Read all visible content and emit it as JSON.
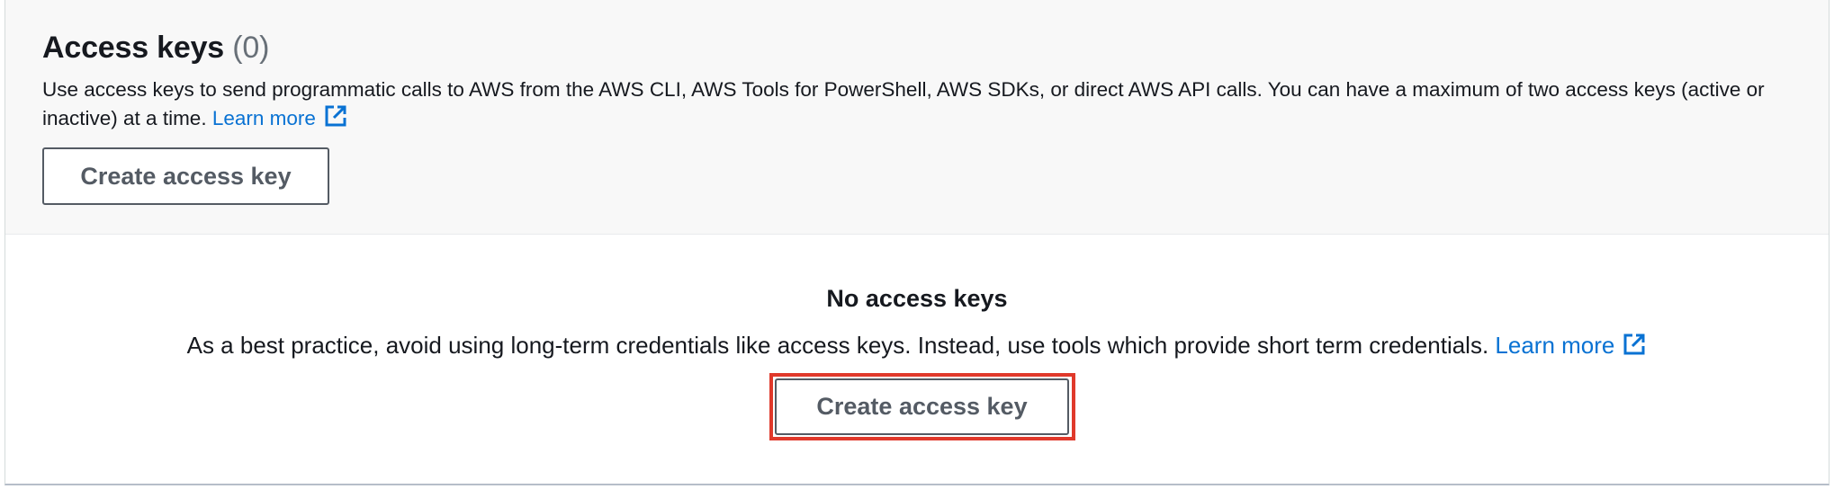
{
  "header": {
    "title": "Access keys",
    "count": "(0)",
    "description": "Use access keys to send programmatic calls to AWS from the AWS CLI, AWS Tools for PowerShell, AWS SDKs, or direct AWS API calls. You can have a maximum of two access keys (active or inactive) at a time.",
    "learn_more": "Learn more",
    "create_button": "Create access key"
  },
  "empty_state": {
    "title": "No access keys",
    "description": "As a best practice, avoid using long-term credentials like access keys. Instead, use tools which provide short term credentials.",
    "learn_more": "Learn more",
    "create_button": "Create access key"
  },
  "icons": {
    "external_link": "external-link-icon"
  },
  "colors": {
    "link": "#0972d3",
    "highlight": "#e0392b",
    "button_border": "#545b64"
  }
}
